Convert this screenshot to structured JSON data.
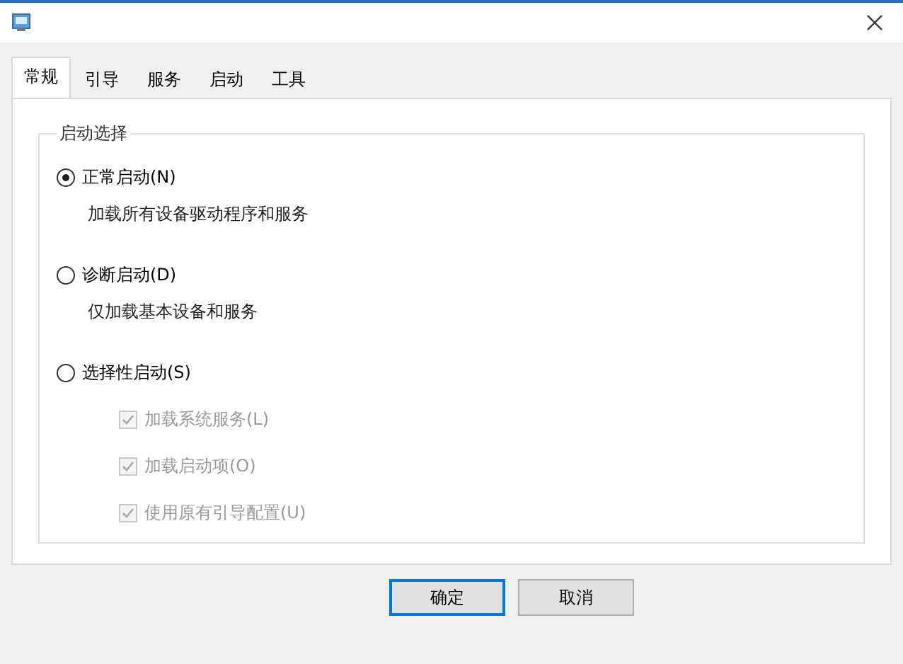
{
  "tabs": [
    {
      "label": "常规",
      "selected": true
    },
    {
      "label": "引导",
      "selected": false
    },
    {
      "label": "服务",
      "selected": false
    },
    {
      "label": "启动",
      "selected": false
    },
    {
      "label": "工具",
      "selected": false
    }
  ],
  "group": {
    "title": "启动选择",
    "options": [
      {
        "label": "正常启动(N)",
        "selected": true,
        "description": "加载所有设备驱动程序和服务"
      },
      {
        "label": "诊断启动(D)",
        "selected": false,
        "description": "仅加载基本设备和服务"
      },
      {
        "label": "选择性启动(S)",
        "selected": false
      }
    ],
    "checkboxes": [
      {
        "label": "加载系统服务(L)",
        "checked": true,
        "disabled": true
      },
      {
        "label": "加载启动项(O)",
        "checked": true,
        "disabled": true
      },
      {
        "label": "使用原有引导配置(U)",
        "checked": true,
        "disabled": true
      }
    ]
  },
  "buttons": [
    {
      "label": "确定",
      "default": true
    },
    {
      "label": "取消",
      "default": false
    }
  ]
}
